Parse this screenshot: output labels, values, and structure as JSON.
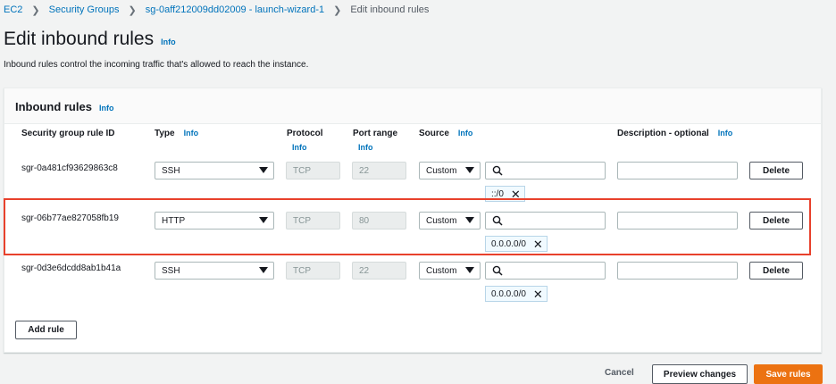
{
  "breadcrumb": {
    "items": [
      "EC2",
      "Security Groups",
      "sg-0aff212009dd02009 - launch-wizard-1"
    ],
    "current": "Edit inbound rules"
  },
  "page": {
    "title": "Edit inbound rules",
    "info": "Info",
    "description": "Inbound rules control the incoming traffic that's allowed to reach the instance."
  },
  "panel": {
    "title": "Inbound rules",
    "info": "Info"
  },
  "columns": {
    "rule_id": "Security group rule ID",
    "type": "Type",
    "protocol": "Protocol",
    "port_range": "Port range",
    "source": "Source",
    "description": "Description - optional",
    "info": "Info"
  },
  "rules": [
    {
      "id": "sgr-0a481cf93629863c8",
      "type": "SSH",
      "protocol": "TCP",
      "port": "22",
      "source_type": "Custom",
      "search_placeholder": "",
      "token": "::/0",
      "description": "",
      "delete": "Delete"
    },
    {
      "id": "sgr-06b77ae827058fb19",
      "type": "HTTP",
      "protocol": "TCP",
      "port": "80",
      "source_type": "Custom",
      "search_placeholder": "",
      "token": "0.0.0.0/0",
      "description": "",
      "delete": "Delete"
    },
    {
      "id": "sgr-0d3e6dcdd8ab1b41a",
      "type": "SSH",
      "protocol": "TCP",
      "port": "22",
      "source_type": "Custom",
      "search_placeholder": "",
      "token": "0.0.0.0/0",
      "description": "",
      "delete": "Delete"
    }
  ],
  "buttons": {
    "add_rule": "Add rule",
    "cancel": "Cancel",
    "preview": "Preview changes",
    "save": "Save rules"
  },
  "colors": {
    "link": "#0073bb",
    "highlight": "#e8412c",
    "primary": "#ec7211"
  },
  "icons": [
    "chevron-right-icon",
    "caret-down-icon",
    "search-icon",
    "close-icon"
  ]
}
